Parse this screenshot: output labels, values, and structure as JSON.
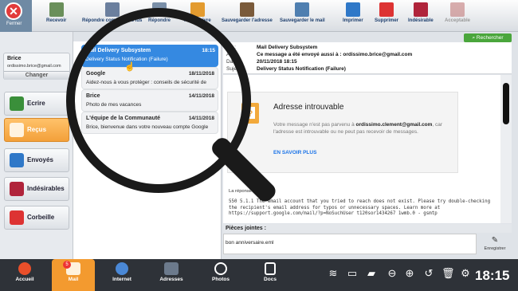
{
  "close": {
    "label": "Fermer"
  },
  "toolbar": [
    {
      "label": "Recevoir",
      "icon": "receive-icon",
      "color": "#6a8f5a"
    },
    {
      "label": "Répondre comme tous lus",
      "icon": "read-all-icon",
      "color": "#6b7f9e"
    },
    {
      "label": "Répondre",
      "icon": "reply-icon",
      "color": "#7a8fa8"
    },
    {
      "label": "Faire suivre",
      "icon": "forward-icon",
      "color": "#e39b2f"
    },
    {
      "label": "Sauvegarder l'adresse",
      "icon": "save-address-icon",
      "color": "#7a5a3a"
    },
    {
      "label": "Sauvegarder le mail",
      "icon": "save-mail-icon",
      "color": "#4f7fb0"
    },
    {
      "label": "Imprimer",
      "icon": "printer-icon",
      "color": "#2f78c8"
    },
    {
      "label": "Supprimer",
      "icon": "trash-icon",
      "color": "#d33"
    },
    {
      "label": "Indésirable",
      "icon": "spam-icon",
      "color": "#b0243b"
    },
    {
      "label": "Acceptable",
      "icon": "acceptable-icon",
      "color": "#c27a7a"
    }
  ],
  "user": {
    "name": "Brice",
    "email": "ordissimo.brice@gmail.com",
    "change": "Changer"
  },
  "folders": [
    {
      "label": "Ecrire",
      "icon": "compose-icon",
      "color": "#3a8f3a"
    },
    {
      "label": "Reçus",
      "icon": "inbox-icon",
      "color": "#ffffff"
    },
    {
      "label": "Envoyés",
      "icon": "sent-icon",
      "color": "#2f78c8"
    },
    {
      "label": "Indésirables",
      "icon": "spam-folder-icon",
      "color": "#b0243b"
    },
    {
      "label": "Corbeille",
      "icon": "trash-folder-icon",
      "color": "#d33"
    }
  ],
  "messages": [
    {
      "from": "Mail Delivery Subsystem",
      "date": "18:15",
      "snippet": "Delivery Status Notification (Failure)"
    },
    {
      "from": "Google",
      "date": "18/11/2018",
      "snippet": "Aidez-nous à vous protéger : conseils de sécurité de"
    },
    {
      "from": "Brice",
      "date": "14/11/2018",
      "snippet": "Photo de mes vacances"
    },
    {
      "from": "L'équipe de la Communauté",
      "date": "14/11/2018",
      "snippet": "Brice, bienvenue dans votre nouveau compte Google"
    }
  ],
  "search": "Rechercher",
  "header": {
    "from_label": "De :",
    "from": "Mail Delivery Subsystem",
    "to_label": "À :",
    "to": "Ce message a été envoyé aussi à : ordissimo.brice@gmail.com",
    "date_label": "Date :",
    "date": "20/11/2018 18:15",
    "subject_label": "Sujet :",
    "subject": "Delivery Status Notification (Failure)"
  },
  "error": {
    "title": "Adresse introuvable",
    "text_pre": "Votre message n'est pas parvenu à",
    "address": "ordissimo.clement@gmail.com",
    "text_post": ", car l'adresse est introuvable ou ne peut pas recevoir de messages.",
    "link": "EN SAVOIR PLUS"
  },
  "reply_label": "La réponse était :",
  "bounce": "550 5.1.1 The email account that you tried to reach does not exist. Please try double-checking the recipient's email address for typos or unnecessary spaces. Learn more at https://support.google.com/mail/?p=NoSuchUser t120sor1434267 1wmb.0 - gsmtp",
  "attachments": {
    "label": "Pièces jointes :",
    "file": "bon anniversaire.eml",
    "save": "Enregistrer"
  },
  "dock": [
    {
      "label": "Accueil",
      "icon": "home-icon"
    },
    {
      "label": "Mail",
      "icon": "mail-icon",
      "badge": "5"
    },
    {
      "label": "Internet",
      "icon": "internet-icon"
    },
    {
      "label": "Adresses",
      "icon": "contacts-icon"
    },
    {
      "label": "Photos",
      "icon": "photos-icon"
    },
    {
      "label": "Docs",
      "icon": "docs-icon"
    }
  ],
  "clock": "18:15"
}
